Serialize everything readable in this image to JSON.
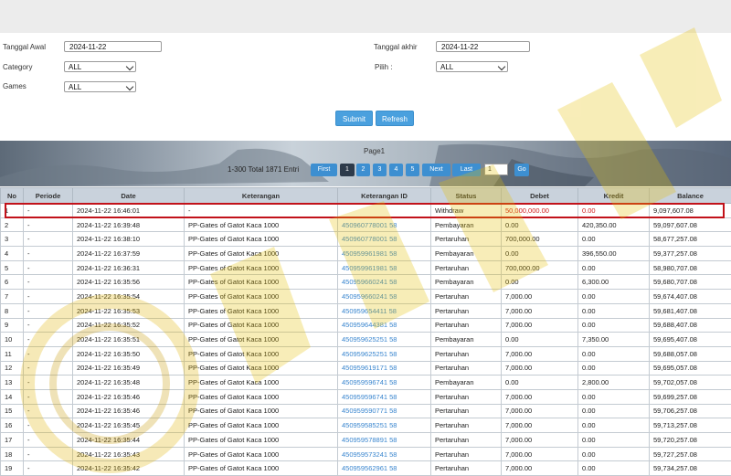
{
  "filters": {
    "tanggal_awal_label": "Tanggal Awal",
    "tanggal_awal_value": "2024-11-22",
    "tanggal_akhir_label": "Tanggal akhir",
    "tanggal_akhir_value": "2024-11-22",
    "category_label": "Category",
    "category_value": "ALL",
    "pilih_label": "Pilih  :",
    "pilih_value": "ALL",
    "games_label": "Games",
    "games_value": "ALL",
    "submit_label": "Submit",
    "refresh_label": "Refresh"
  },
  "pagination": {
    "page_label": "Page1",
    "total_text": "1-300 Total 1871 Entri",
    "first_label": "First",
    "pages": [
      "1",
      "2",
      "3",
      "4",
      "5"
    ],
    "next_label": "Next",
    "last_label": "Last",
    "page_input_value": "1",
    "go_label": "Go"
  },
  "table": {
    "headers": [
      "No",
      "Periode",
      "Date",
      "Keterangan",
      "Keterangan ID",
      "Status",
      "Debet",
      "Kredit",
      "Balance"
    ],
    "rows": [
      [
        "1",
        "-",
        "2024-11-22 16:46:01",
        "-",
        "",
        "Withdraw",
        "50,000,000.00",
        "0.00",
        "9,097,607.08"
      ],
      [
        "2",
        "-",
        "2024-11-22 16:39:48",
        "PP-Gates of Gatot Kaca 1000",
        "450960778001 58",
        "Pembayaran",
        "0.00",
        "420,350.00",
        "59,097,607.08"
      ],
      [
        "3",
        "-",
        "2024-11-22 16:38:10",
        "PP-Gates of Gatot Kaca 1000",
        "450960778001 58",
        "Pertaruhan",
        "700,000.00",
        "0.00",
        "58,677,257.08"
      ],
      [
        "4",
        "-",
        "2024-11-22 16:37:59",
        "PP-Gates of Gatot Kaca 1000",
        "450959961981 58",
        "Pembayaran",
        "0.00",
        "396,550.00",
        "59,377,257.08"
      ],
      [
        "5",
        "-",
        "2024-11-22 16:36:31",
        "PP-Gates of Gatot Kaca 1000",
        "450959961981 58",
        "Pertaruhan",
        "700,000.00",
        "0.00",
        "58,980,707.08"
      ],
      [
        "6",
        "-",
        "2024-11-22 16:35:56",
        "PP-Gates of Gatot Kaca 1000",
        "450959660241 58",
        "Pembayaran",
        "0.00",
        "6,300.00",
        "59,680,707.08"
      ],
      [
        "7",
        "-",
        "2024-11-22 16:35:54",
        "PP-Gates of Gatot Kaca 1000",
        "450959660241 58",
        "Pertaruhan",
        "7,000.00",
        "0.00",
        "59,674,407.08"
      ],
      [
        "8",
        "-",
        "2024-11-22 16:35:53",
        "PP-Gates of Gatot Kaca 1000",
        "450959654411 58",
        "Pertaruhan",
        "7,000.00",
        "0.00",
        "59,681,407.08"
      ],
      [
        "9",
        "-",
        "2024-11-22 16:35:52",
        "PP-Gates of Gatot Kaca 1000",
        "450959644381 58",
        "Pertaruhan",
        "7,000.00",
        "0.00",
        "59,688,407.08"
      ],
      [
        "10",
        "-",
        "2024-11-22 16:35:51",
        "PP-Gates of Gatot Kaca 1000",
        "450959625251 58",
        "Pembayaran",
        "0.00",
        "7,350.00",
        "59,695,407.08"
      ],
      [
        "11",
        "-",
        "2024-11-22 16:35:50",
        "PP-Gates of Gatot Kaca 1000",
        "450959625251 58",
        "Pertaruhan",
        "7,000.00",
        "0.00",
        "59,688,057.08"
      ],
      [
        "12",
        "-",
        "2024-11-22 16:35:49",
        "PP-Gates of Gatot Kaca 1000",
        "450959619171 58",
        "Pertaruhan",
        "7,000.00",
        "0.00",
        "59,695,057.08"
      ],
      [
        "13",
        "-",
        "2024-11-22 16:35:48",
        "PP-Gates of Gatot Kaca 1000",
        "450959596741 58",
        "Pembayaran",
        "0.00",
        "2,800.00",
        "59,702,057.08"
      ],
      [
        "14",
        "-",
        "2024-11-22 16:35:46",
        "PP-Gates of Gatot Kaca 1000",
        "450959596741 58",
        "Pertaruhan",
        "7,000.00",
        "0.00",
        "59,699,257.08"
      ],
      [
        "15",
        "-",
        "2024-11-22 16:35:46",
        "PP-Gates of Gatot Kaca 1000",
        "450959590771 58",
        "Pertaruhan",
        "7,000.00",
        "0.00",
        "59,706,257.08"
      ],
      [
        "16",
        "-",
        "2024-11-22 16:35:45",
        "PP-Gates of Gatot Kaca 1000",
        "450959585251 58",
        "Pertaruhan",
        "7,000.00",
        "0.00",
        "59,713,257.08"
      ],
      [
        "17",
        "-",
        "2024-11-22 16:35:44",
        "PP-Gates of Gatot Kaca 1000",
        "450959578891 58",
        "Pertaruhan",
        "7,000.00",
        "0.00",
        "59,720,257.08"
      ],
      [
        "18",
        "-",
        "2024-11-22 16:35:43",
        "PP-Gates of Gatot Kaca 1000",
        "450959573241 58",
        "Pertaruhan",
        "7,000.00",
        "0.00",
        "59,727,257.08"
      ],
      [
        "19",
        "-",
        "2024-11-22 16:35:42",
        "PP-Gates of Gatot Kaca 1000",
        "450959562961 58",
        "Pertaruhan",
        "7,000.00",
        "0.00",
        "59,734,257.08"
      ]
    ]
  },
  "colors": {
    "link": "#3a86cf",
    "highlight": "#c2121a",
    "button": "#4aa0de"
  }
}
